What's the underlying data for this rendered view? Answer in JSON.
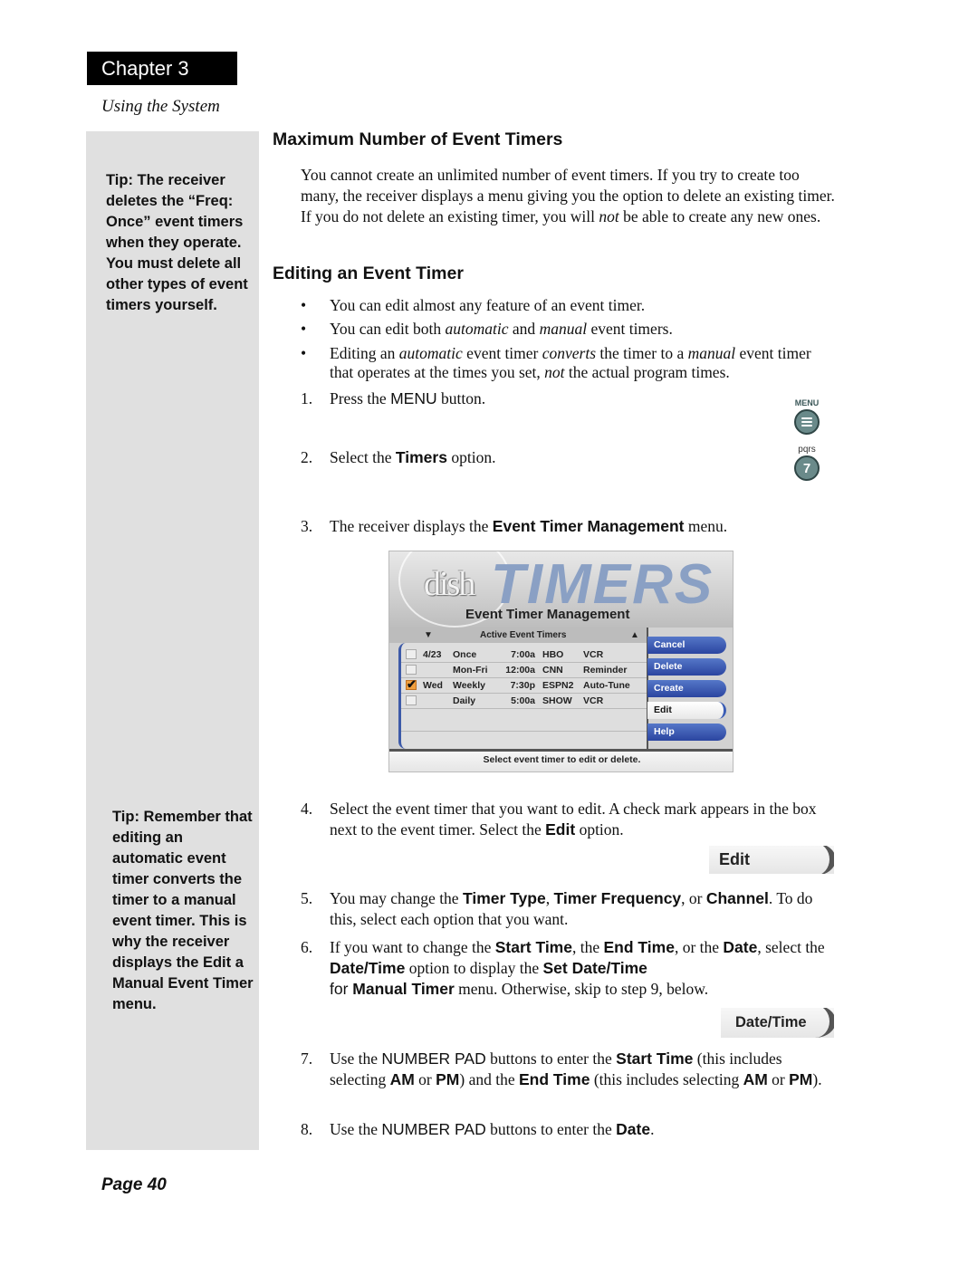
{
  "header": {
    "chapter": "Chapter 3",
    "section": "Using the System"
  },
  "sidebar": {
    "tips": [
      "Tip: The receiver deletes the “Freq: Once” event timers when they operate. You must delete all other types of event timers yourself.",
      "Tip: Remember that editing an automatic event timer converts the timer to a manual event timer. This is why the receiver displays the Edit a Manual Event Timer menu."
    ]
  },
  "footer": {
    "page": "Page 40"
  },
  "sections": {
    "max_timers": {
      "heading": "Maximum Number of Event Timers",
      "body": {
        "a": "You cannot create an unlimited number of event timers. If you try to create too many, the receiver displays a menu giving you the option to delete an existing timer. If you do not delete an existing timer, you will ",
        "em": "not",
        "b": " be able to create any new ones."
      }
    },
    "editing": {
      "heading": "Editing an Event Timer",
      "bullets": {
        "b1": "You can edit almost any feature of an event timer.",
        "b2": {
          "a": "You can edit both ",
          "em1": "automatic",
          "b": " and ",
          "em2": "manual",
          "c": " event timers."
        },
        "b3": {
          "a": "Editing an ",
          "em1": "automatic",
          "b": " event timer ",
          "em2": "converts",
          "c": " the timer to a ",
          "em3": "manual",
          "d": " event timer that operates at the times you set, ",
          "em4": "not",
          "e": " the actual program times."
        }
      },
      "bullet_char": "•"
    }
  },
  "steps": {
    "s1": {
      "num": "1.",
      "a": "Press the ",
      "k1": "MENU",
      "b": " button."
    },
    "s2": {
      "num": "2.",
      "a": "Select the ",
      "k1": "Timers",
      "b": " option."
    },
    "s3": {
      "num": "3.",
      "a": "The receiver displays the ",
      "k1": "Event Timer Management",
      "b": " menu."
    },
    "s4": {
      "num": "4.",
      "a": "Select the event timer that you want to edit. A check mark appears in the box next to the event timer. Select the ",
      "k1": "Edit",
      "b": " option."
    },
    "s5": {
      "num": "5.",
      "a": "You may change the ",
      "k1": "Timer Type",
      "b": ", ",
      "k2": "Timer Frequency",
      "c": ", or ",
      "k3": "Channel",
      "d": ". To do this, select each option that you want."
    },
    "s6": {
      "num": "6.",
      "a": "If you want to change the ",
      "k1": "Start Time",
      "b": ", the ",
      "k2": "End Time",
      "c": ", or the ",
      "k3": "Date",
      "d": ", select the ",
      "k4": "Date/Time",
      "e": " option to display the ",
      "k5": "Set Date/Time",
      "f": "for ",
      "k6": "Manual Timer",
      "g": " menu. Otherwise, skip to step 9, below."
    },
    "s7": {
      "num": "7.",
      "a": "Use the ",
      "k0": "NUMBER PAD",
      "b": " buttons to enter the ",
      "k1": "Start Time",
      "c": " (this includes selecting ",
      "k2": "AM",
      "d": " or ",
      "k3": "PM",
      "e": ") and the ",
      "k4": "End Time",
      "f": " (this includes selecting ",
      "k5": "AM",
      "g": " or ",
      "k6": "PM",
      "h": ")."
    },
    "s8": {
      "num": "8.",
      "a": "Use the ",
      "k0": "NUMBER PAD",
      "b": " buttons to enter the ",
      "k1": "Date",
      "c": "."
    }
  },
  "remote_buttons": {
    "menu": {
      "label": "MENU",
      "icon": "menu-lines-icon"
    },
    "seven": {
      "label": "pqrs",
      "digit": "7"
    }
  },
  "tv_menu": {
    "logo": "dish",
    "banner": "TIMERS",
    "title": "Event Timer Management",
    "list_header": "Active Event Timers",
    "scroll_down": "▼",
    "scroll_up": "▲",
    "rows": [
      {
        "checked": false,
        "date": "4/23",
        "freq": "Once",
        "time": "7:00a",
        "channel": "HBO",
        "action": "VCR"
      },
      {
        "checked": false,
        "date": "",
        "freq": "Mon-Fri",
        "time": "12:00a",
        "channel": "CNN",
        "action": "Reminder"
      },
      {
        "checked": true,
        "date": "Wed",
        "freq": "Weekly",
        "time": "7:30p",
        "channel": "ESPN2",
        "action": "Auto-Tune"
      },
      {
        "checked": false,
        "date": "",
        "freq": "Daily",
        "time": "5:00a",
        "channel": "SHOW",
        "action": "VCR"
      }
    ],
    "buttons": [
      "Cancel",
      "Delete",
      "Create",
      "Edit",
      "Help"
    ],
    "selected_button": "Edit",
    "footer": "Select event timer to edit or delete."
  },
  "option_buttons": {
    "edit": "Edit",
    "datetime": "Date/Time"
  },
  "colors": {
    "sidebar_bg": "#e0e0e0",
    "tv_button_blue": "#2b45a0",
    "banner_text": "#8aa0c4",
    "check_orange": "#f0a040"
  }
}
